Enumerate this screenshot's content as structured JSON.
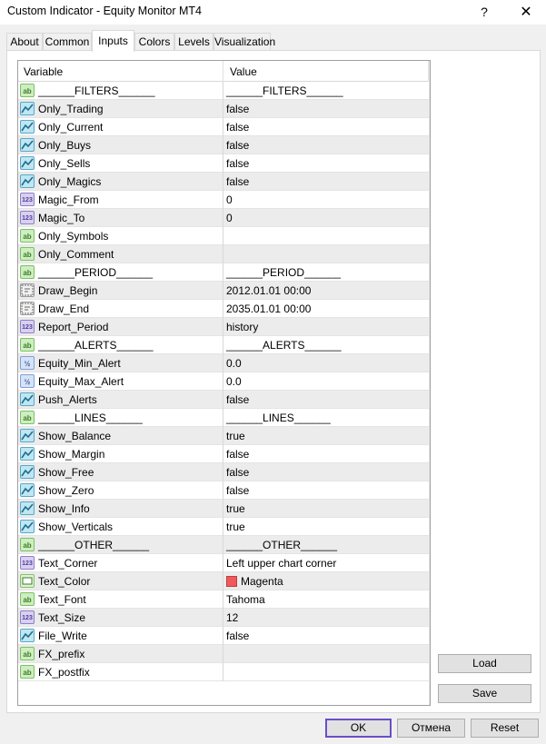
{
  "window": {
    "title": "Custom Indicator - Equity Monitor MT4",
    "help_label": "?",
    "close_label": "✕"
  },
  "tabs": [
    "About",
    "Common",
    "Inputs",
    "Colors",
    "Levels",
    "Visualization"
  ],
  "active_tab": "Inputs",
  "grid": {
    "headers": {
      "variable": "Variable",
      "value": "Value"
    },
    "rows": [
      {
        "icon": "ab",
        "type": "str",
        "variable": "______FILTERS______",
        "value": "______FILTERS______"
      },
      {
        "icon": "bool",
        "type": "bool",
        "variable": "Only_Trading",
        "value": "false"
      },
      {
        "icon": "bool",
        "type": "bool",
        "variable": "Only_Current",
        "value": "false"
      },
      {
        "icon": "bool",
        "type": "bool",
        "variable": "Only_Buys",
        "value": "false"
      },
      {
        "icon": "bool",
        "type": "bool",
        "variable": "Only_Sells",
        "value": "false"
      },
      {
        "icon": "bool",
        "type": "bool",
        "variable": "Only_Magics",
        "value": "false"
      },
      {
        "icon": "123",
        "type": "int",
        "variable": "Magic_From",
        "value": "0"
      },
      {
        "icon": "123",
        "type": "int",
        "variable": "Magic_To",
        "value": "0"
      },
      {
        "icon": "ab",
        "type": "str",
        "variable": "Only_Symbols",
        "value": ""
      },
      {
        "icon": "ab",
        "type": "str",
        "variable": "Only_Comment",
        "value": ""
      },
      {
        "icon": "ab",
        "type": "str",
        "variable": "______PERIOD______",
        "value": "______PERIOD______"
      },
      {
        "icon": "date",
        "type": "date",
        "variable": "Draw_Begin",
        "value": "2012.01.01 00:00"
      },
      {
        "icon": "date",
        "type": "date",
        "variable": "Draw_End",
        "value": "2035.01.01 00:00"
      },
      {
        "icon": "123",
        "type": "int",
        "variable": "Report_Period",
        "value": "history"
      },
      {
        "icon": "ab",
        "type": "str",
        "variable": "______ALERTS______",
        "value": "______ALERTS______"
      },
      {
        "icon": "v2",
        "type": "dbl",
        "variable": "Equity_Min_Alert",
        "value": "0.0"
      },
      {
        "icon": "v2",
        "type": "dbl",
        "variable": "Equity_Max_Alert",
        "value": "0.0"
      },
      {
        "icon": "bool",
        "type": "bool",
        "variable": "Push_Alerts",
        "value": "false"
      },
      {
        "icon": "ab",
        "type": "str",
        "variable": "______LINES______",
        "value": "______LINES______"
      },
      {
        "icon": "bool",
        "type": "bool",
        "variable": "Show_Balance",
        "value": "true"
      },
      {
        "icon": "bool",
        "type": "bool",
        "variable": "Show_Margin",
        "value": "false"
      },
      {
        "icon": "bool",
        "type": "bool",
        "variable": "Show_Free",
        "value": "false"
      },
      {
        "icon": "bool",
        "type": "bool",
        "variable": "Show_Zero",
        "value": "false"
      },
      {
        "icon": "bool",
        "type": "bool",
        "variable": "Show_Info",
        "value": "true"
      },
      {
        "icon": "bool",
        "type": "bool",
        "variable": "Show_Verticals",
        "value": "true"
      },
      {
        "icon": "ab",
        "type": "str",
        "variable": "______OTHER______",
        "value": "______OTHER______"
      },
      {
        "icon": "123",
        "type": "int",
        "variable": "Text_Corner",
        "value": "Left upper chart corner"
      },
      {
        "icon": "color",
        "type": "color",
        "variable": "Text_Color",
        "value": "Magenta",
        "swatch": "#f05a5a"
      },
      {
        "icon": "ab",
        "type": "str",
        "variable": "Text_Font",
        "value": "Tahoma"
      },
      {
        "icon": "123",
        "type": "int",
        "variable": "Text_Size",
        "value": "12"
      },
      {
        "icon": "bool",
        "type": "bool",
        "variable": "File_Write",
        "value": "false"
      },
      {
        "icon": "ab",
        "type": "str",
        "variable": "FX_prefix",
        "value": ""
      },
      {
        "icon": "ab",
        "type": "str",
        "variable": "FX_postfix",
        "value": ""
      }
    ]
  },
  "buttons": {
    "load": "Load",
    "save": "Save",
    "ok": "OK",
    "cancel": "Отмена",
    "reset": "Reset"
  },
  "colors": {
    "accent": "#6b4ec8"
  }
}
